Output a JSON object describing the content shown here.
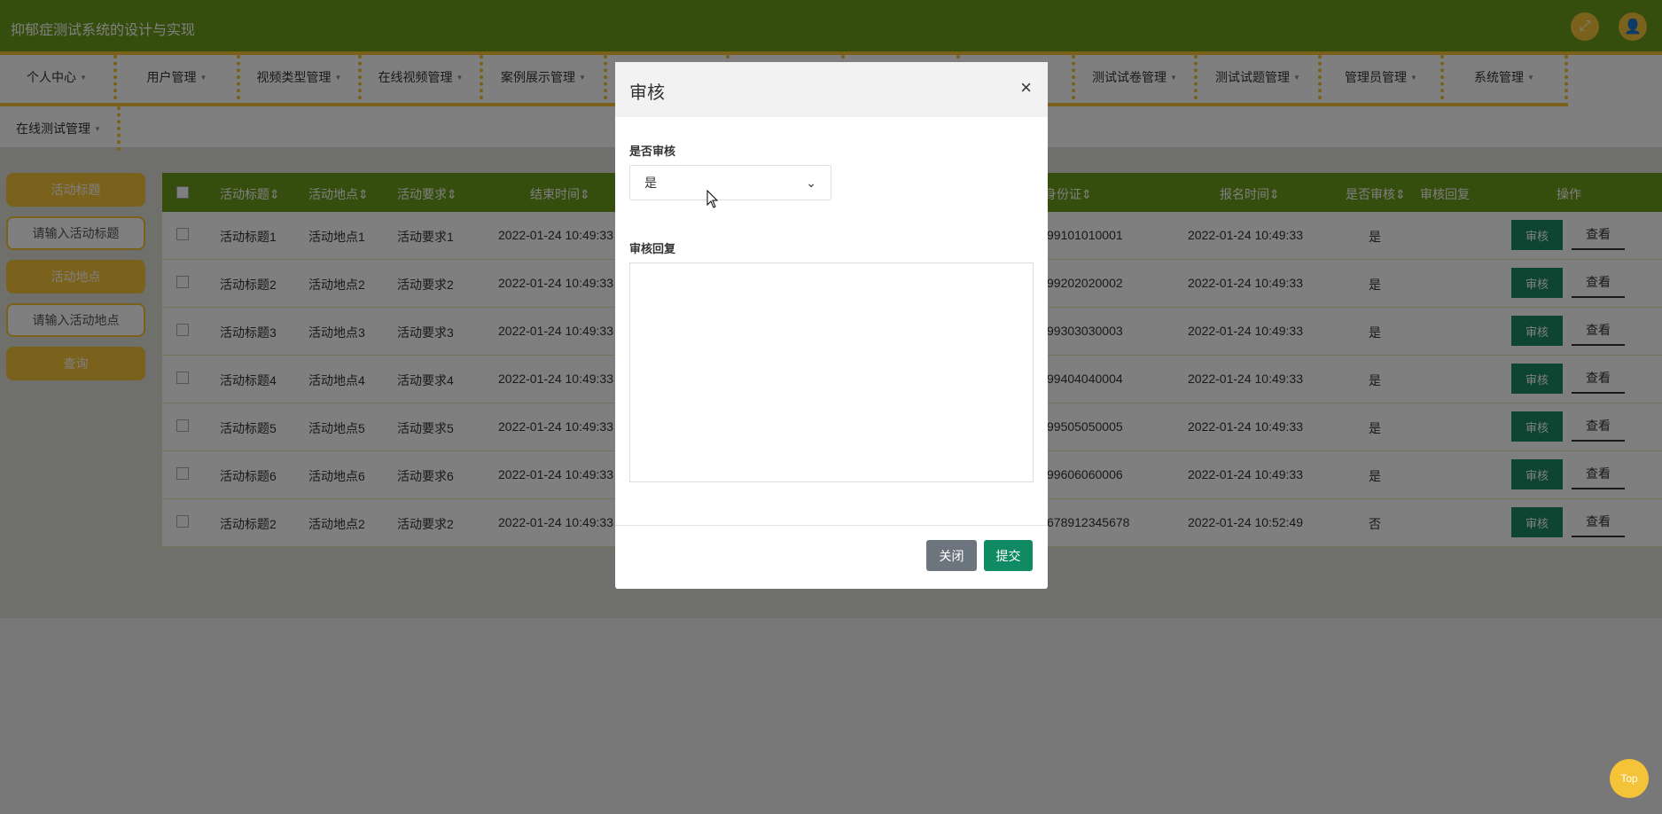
{
  "app": {
    "title": "抑郁症测试系统的设计与实现"
  },
  "header": {
    "fullscreen_icon": "fullscreen-icon",
    "user_icon": "user-icon"
  },
  "nav": {
    "row1": [
      "个人中心",
      "用户管理",
      "视频类型管理",
      "在线视频管理",
      "案例展示管理",
      "",
      "",
      "",
      "",
      "测试试卷管理",
      "测试试题管理",
      "管理员管理",
      "系统管理"
    ],
    "row2": [
      "在线测试管理"
    ],
    "partial_fragment": "系"
  },
  "search": {
    "title_label": "活动标题",
    "title_placeholder": "请输入活动标题",
    "location_label": "活动地点",
    "location_placeholder": "请输入活动地点",
    "query_button": "查询"
  },
  "table": {
    "headers": {
      "title": "活动标题",
      "location": "活动地点",
      "requirement": "活动要求",
      "end_time": "结束时间",
      "id_card": "身份证",
      "signup_time": "报名时间",
      "audited": "是否审核",
      "reply": "审核回复",
      "actions": "操作"
    },
    "sort_icon": "sort-icon",
    "rows": [
      {
        "title": "活动标题1",
        "location": "活动地点1",
        "requirement": "活动要求1",
        "end_time": "2022-01-24 10:49:33",
        "id_card": "99101010001",
        "signup_time": "2022-01-24 10:49:33",
        "audited": "是"
      },
      {
        "title": "活动标题2",
        "location": "活动地点2",
        "requirement": "活动要求2",
        "end_time": "2022-01-24 10:49:33",
        "id_card": "99202020002",
        "signup_time": "2022-01-24 10:49:33",
        "audited": "是"
      },
      {
        "title": "活动标题3",
        "location": "活动地点3",
        "requirement": "活动要求3",
        "end_time": "2022-01-24 10:49:33",
        "id_card": "99303030003",
        "signup_time": "2022-01-24 10:49:33",
        "audited": "是"
      },
      {
        "title": "活动标题4",
        "location": "活动地点4",
        "requirement": "活动要求4",
        "end_time": "2022-01-24 10:49:33",
        "id_card": "99404040004",
        "signup_time": "2022-01-24 10:49:33",
        "audited": "是"
      },
      {
        "title": "活动标题5",
        "location": "活动地点5",
        "requirement": "活动要求5",
        "end_time": "2022-01-24 10:49:33",
        "id_card": "99505050005",
        "signup_time": "2022-01-24 10:49:33",
        "audited": "是"
      },
      {
        "title": "活动标题6",
        "location": "活动地点6",
        "requirement": "活动要求6",
        "end_time": "2022-01-24 10:49:33",
        "id_card": "99606060006",
        "signup_time": "2022-01-24 10:49:33",
        "audited": "是"
      },
      {
        "title": "活动标题2",
        "location": "活动地点2",
        "requirement": "活动要求2",
        "end_time": "2022-01-24 10:49:33",
        "id_card": "678912345678",
        "signup_time": "2022-01-24 10:52:49",
        "audited": "否"
      }
    ],
    "audit_button": "审核",
    "view_button": "查看"
  },
  "modal": {
    "title": "审核",
    "close_icon": "×",
    "audit_label": "是否审核",
    "audit_value": "是",
    "reply_label": "审核回复",
    "reply_value": "",
    "close_button": "关闭",
    "submit_button": "提交"
  },
  "top_button": "Top",
  "colors": {
    "primary": "#6b9a1b",
    "accent": "#f5c338",
    "action": "#1a8a64"
  }
}
